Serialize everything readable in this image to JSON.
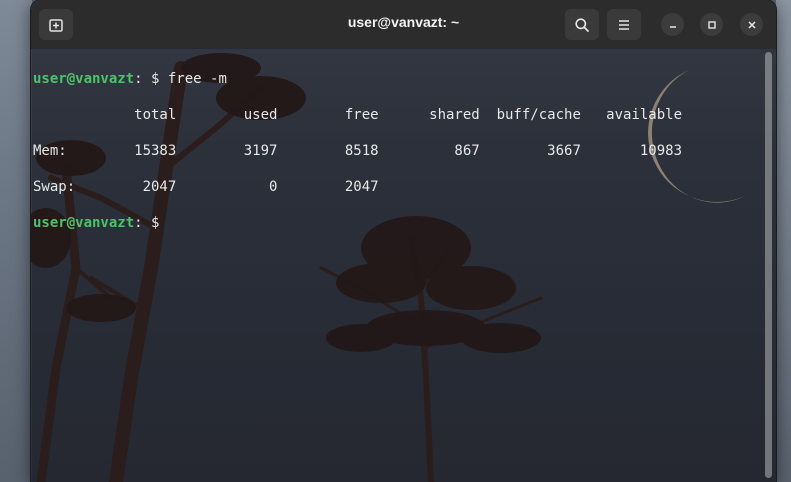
{
  "window": {
    "title": "user@vanvazt: ~"
  },
  "header_icons": {
    "new_tab": "new-tab-icon",
    "search": "search-icon",
    "menu": "hamburger-menu-icon",
    "minimize": "minimize-icon",
    "maximize": "maximize-icon",
    "close": "close-icon"
  },
  "terminal": {
    "line1": {
      "prompt": "user@vanvazt",
      "sep": ": $ ",
      "command": "free -m"
    },
    "header_row": "            total        used        free      shared  buff/cache   available",
    "mem_row": "Mem:        15383        3197        8518         867        3667       10983",
    "swap_row": "Swap:        2047           0        2047",
    "line_last": {
      "prompt": "user@vanvazt",
      "sep": ": $ "
    }
  },
  "colors": {
    "prompt": "#4ec26a",
    "text": "#e8e8e8",
    "headerbar": "#2c2c2c"
  }
}
